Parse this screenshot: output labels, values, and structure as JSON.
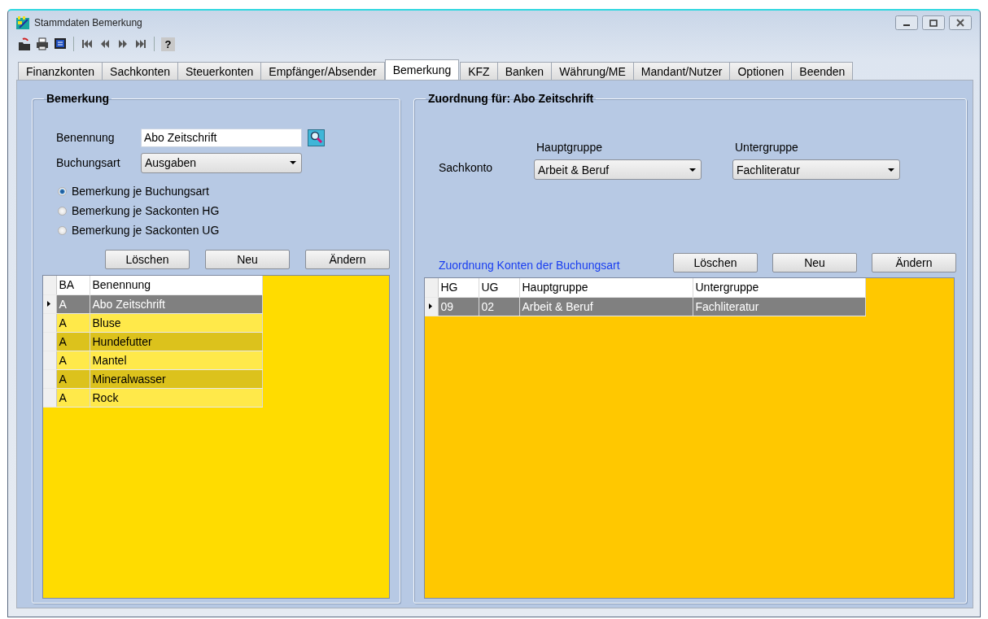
{
  "window": {
    "title": "Stammdaten Bemerkung"
  },
  "toolbar": {
    "help": "?"
  },
  "tabs": [
    {
      "label": "Finanzkonten",
      "selected": false
    },
    {
      "label": "Sachkonten",
      "selected": false
    },
    {
      "label": "Steuerkonten",
      "selected": false
    },
    {
      "label": "Empfänger/Absender",
      "selected": false
    },
    {
      "label": "Bemerkung",
      "selected": true
    },
    {
      "label": "KFZ",
      "selected": false
    },
    {
      "label": "Banken",
      "selected": false
    },
    {
      "label": "Währung/ME",
      "selected": false
    },
    {
      "label": "Mandant/Nutzer",
      "selected": false
    },
    {
      "label": "Optionen",
      "selected": false
    },
    {
      "label": "Beenden",
      "selected": false
    }
  ],
  "left_panel": {
    "title": "Bemerkung",
    "fields": [
      {
        "kind": "text",
        "label": "Benennung",
        "value": "Abo Zeitschrift"
      },
      {
        "kind": "select",
        "label": "Buchungsart",
        "value": "Ausgaben"
      }
    ],
    "options": [
      {
        "label": "Bemerkung je Buchungsart",
        "selected": true
      },
      {
        "label": "Bemerkung je Sackonten HG",
        "selected": false
      },
      {
        "label": "Bemerkung je Sackonten UG",
        "selected": false
      }
    ],
    "buttons": [
      "Löschen",
      "Neu",
      "Ändern"
    ],
    "table": {
      "columns": [
        "BA",
        "Benennung"
      ],
      "rows": [
        {
          "cells": [
            "A",
            "Abo Zeitschrift"
          ],
          "selected": true
        },
        {
          "cells": [
            "A",
            "Bluse"
          ],
          "selected": false
        },
        {
          "cells": [
            "A",
            "Hundefutter"
          ],
          "selected": false
        },
        {
          "cells": [
            "A",
            "Mantel"
          ],
          "selected": false
        },
        {
          "cells": [
            "A",
            "Mineralwasser"
          ],
          "selected": false
        },
        {
          "cells": [
            "A",
            "Rock"
          ],
          "selected": false
        }
      ]
    }
  },
  "right_panel": {
    "title": "Zuordnung für: Abo Zeitschrift",
    "field_label": "Sachkonto",
    "selects": [
      {
        "label": "Hauptgruppe",
        "value": "Arbeit & Beruf"
      },
      {
        "label": "Untergruppe",
        "value": "Fachliteratur"
      }
    ],
    "table_caption": "Zuordnung Konten der Buchungsart",
    "buttons": [
      "Löschen",
      "Neu",
      "Ändern"
    ],
    "table": {
      "columns": [
        "HG",
        "UG",
        "Hauptgruppe",
        "Untergruppe"
      ],
      "rows": [
        {
          "cells": [
            "09",
            "02",
            "Arbeit & Beruf",
            "Fachliteratur"
          ],
          "selected": true
        }
      ]
    }
  }
}
